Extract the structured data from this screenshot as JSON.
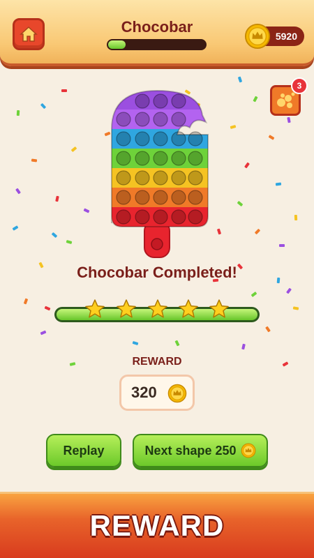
{
  "header": {
    "title": "Chocobar",
    "progress_fraction": 0.18,
    "coins": "5920",
    "home_icon": "home-icon"
  },
  "hint": {
    "icon": "hint-bubbles-icon",
    "badge_count": "3"
  },
  "puzzle": {
    "shape": "chocobar-popit",
    "row_colors": [
      "#9b4fe0",
      "#b363f0",
      "#2fa6e0",
      "#6ed23a",
      "#f5c322",
      "#f07a28",
      "#e8242e"
    ],
    "stick_color": "#e8242e"
  },
  "result": {
    "completed_text": "Chocobar Completed!",
    "stars": 5
  },
  "reward": {
    "label": "REWARD",
    "amount": "320"
  },
  "buttons": {
    "replay_label": "Replay",
    "next_label": "Next shape 250"
  },
  "banner": {
    "text": "REWARD"
  },
  "colors": {
    "accent_red": "#7a1f1a",
    "green": "#6cc92a",
    "gold": "#f5b800"
  }
}
